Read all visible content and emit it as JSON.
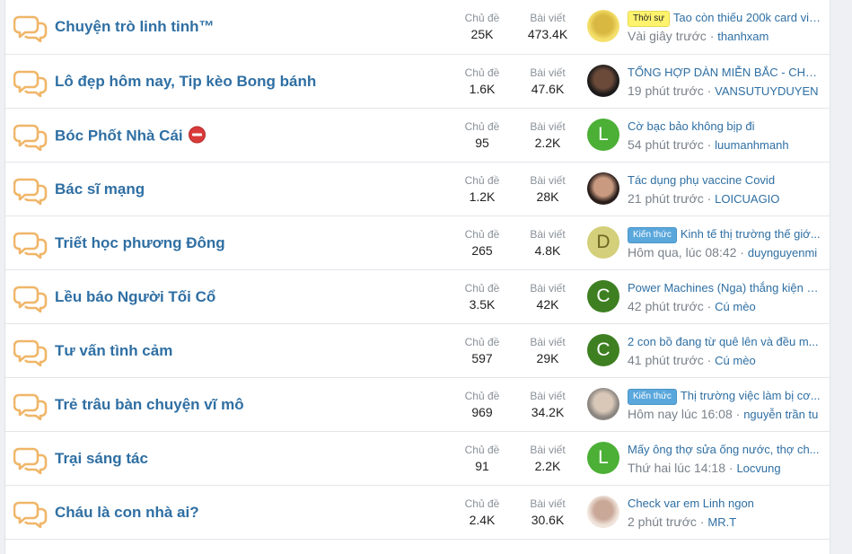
{
  "forums": [
    {
      "title": "Chuyện trò linh tinh™",
      "threads": "25K",
      "posts": "473.4K",
      "latest": {
        "prefix": "Thời sự",
        "prefix_color": "yellow",
        "title": "Tao còn thiếu 200k card vin...",
        "time": "Vài giây trước",
        "user": "thanhxam"
      },
      "avatar": {
        "kind": "image",
        "bg": "#f4df6a",
        "fg": "#d8b840"
      }
    },
    {
      "title": "Lô đẹp hôm nay, Tip kèo Bong bánh",
      "threads": "1.6K",
      "posts": "47.6K",
      "latest": {
        "prefix": "",
        "title": "TỔNG HỢP DÀN MIỄN BẮC - CHÚ...",
        "time": "19 phút trước",
        "user": "VANSUTUYDUYEN"
      },
      "avatar": {
        "kind": "image",
        "bg": "#1c1a1a",
        "fg": "#6b4a3a"
      }
    },
    {
      "title": "Bóc Phốt Nhà Cái",
      "badge": true,
      "threads": "95",
      "posts": "2.2K",
      "latest": {
        "prefix": "",
        "title": "Cờ bạc bảo không bịp đi",
        "time": "54 phút trước",
        "user": "luumanhmanh"
      },
      "avatar": {
        "kind": "letter",
        "letter": "L",
        "bg": "#4caf36"
      }
    },
    {
      "title": "Bác sĩ mạng",
      "threads": "1.2K",
      "posts": "28K",
      "latest": {
        "prefix": "",
        "title": "Tác dụng phụ vaccine Covid",
        "time": "21 phút trước",
        "user": "LOICUAGIO"
      },
      "avatar": {
        "kind": "image",
        "bg": "#2a1e1b",
        "fg": "#c99a7f"
      }
    },
    {
      "title": "Triết học phương Đông",
      "threads": "265",
      "posts": "4.8K",
      "latest": {
        "prefix": "Kiến thức",
        "prefix_color": "blue",
        "title": "Kinh tế thị trường thế giớ...",
        "time": "Hôm qua, lúc 08:42",
        "user": "duynguyenmi"
      },
      "avatar": {
        "kind": "letter",
        "letter": "D",
        "bg": "#d3cf7a",
        "fg": "#6a6620"
      }
    },
    {
      "title": "Lều báo Người Tối Cổ",
      "threads": "3.5K",
      "posts": "42K",
      "latest": {
        "prefix": "",
        "title": "Power Machines (Nga) thắng kiện P...",
        "time": "42 phút trước",
        "user": "Cú mèo"
      },
      "avatar": {
        "kind": "letter",
        "letter": "C",
        "bg": "#3e7f22"
      }
    },
    {
      "title": "Tư vấn tình cảm",
      "threads": "597",
      "posts": "29K",
      "latest": {
        "prefix": "",
        "title": "2 con bồ đang từ quê lên và đều m...",
        "time": "41 phút trước",
        "user": "Cú mèo"
      },
      "avatar": {
        "kind": "letter",
        "letter": "C",
        "bg": "#3e7f22"
      }
    },
    {
      "title": "Trẻ trâu bàn chuyện vĩ mô",
      "threads": "969",
      "posts": "34.2K",
      "latest": {
        "prefix": "Kiến thức",
        "prefix_color": "blue",
        "title": "Thị trường việc làm bị cơ...",
        "time": "Hôm nay lúc 16:08",
        "user": "nguyễn trần tu"
      },
      "avatar": {
        "kind": "image",
        "bg": "#8a8580",
        "fg": "#d9c8b8"
      }
    },
    {
      "title": "Trại sáng tác",
      "threads": "91",
      "posts": "2.2K",
      "latest": {
        "prefix": "",
        "title": "Mấy ông thợ sửa ống nước, thợ ch...",
        "time": "Thứ hai lúc 14:18",
        "user": "Locvung"
      },
      "avatar": {
        "kind": "letter",
        "letter": "L",
        "bg": "#4caf36"
      }
    },
    {
      "title": "Cháu là con nhà ai?",
      "threads": "2.4K",
      "posts": "30.6K",
      "latest": {
        "prefix": "",
        "title": "Check var em Linh ngon",
        "time": "2 phút trước",
        "user": "MR.T"
      },
      "avatar": {
        "kind": "image",
        "bg": "#efe3da",
        "fg": "#c9a898"
      }
    }
  ],
  "labels": {
    "threads": "Chủ đề",
    "posts": "Bài viết"
  }
}
